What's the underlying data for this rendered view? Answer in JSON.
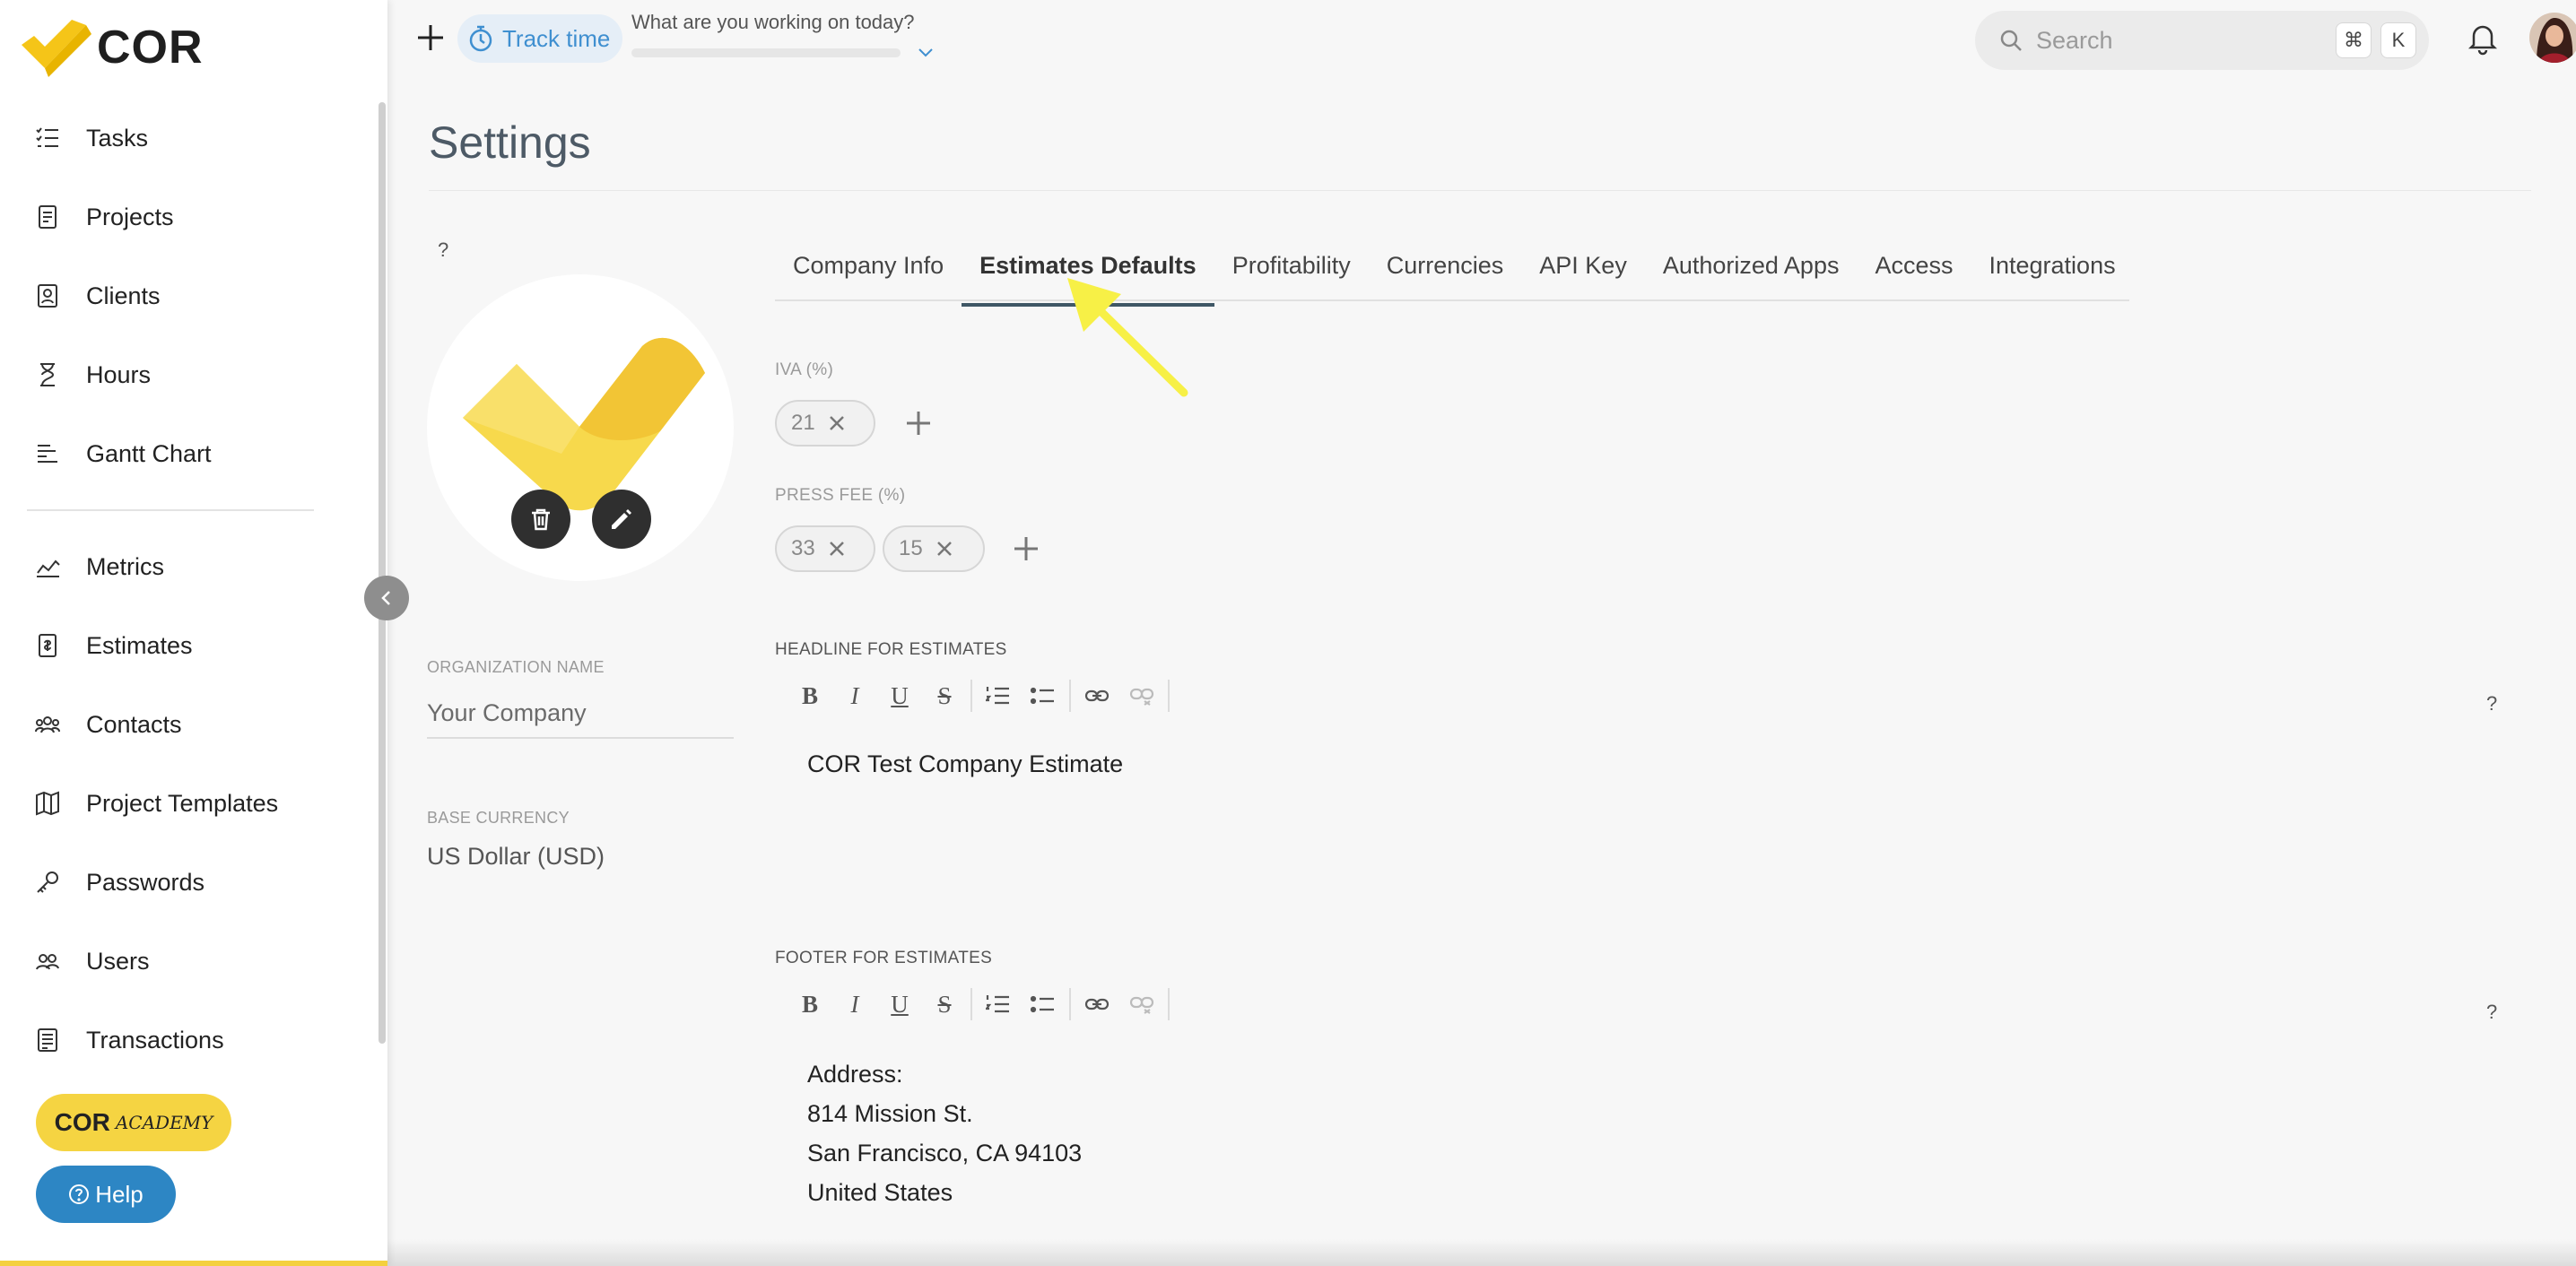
{
  "brand": {
    "name": "COR",
    "accent": "#f5d442"
  },
  "sidebar": {
    "items_top": [
      {
        "label": "Tasks",
        "icon": "tasks-icon"
      },
      {
        "label": "Projects",
        "icon": "projects-icon"
      },
      {
        "label": "Clients",
        "icon": "clients-icon"
      },
      {
        "label": "Hours",
        "icon": "hourglass-icon"
      },
      {
        "label": "Gantt Chart",
        "icon": "gantt-icon"
      }
    ],
    "items_bottom": [
      {
        "label": "Metrics",
        "icon": "metrics-icon"
      },
      {
        "label": "Estimates",
        "icon": "estimates-icon"
      },
      {
        "label": "Contacts",
        "icon": "contacts-icon"
      },
      {
        "label": "Project Templates",
        "icon": "map-icon"
      },
      {
        "label": "Passwords",
        "icon": "key-icon"
      },
      {
        "label": "Users",
        "icon": "users-icon"
      },
      {
        "label": "Transactions",
        "icon": "transactions-icon"
      }
    ],
    "academy": {
      "main": "COR",
      "sub": "ACADEMY"
    },
    "help_label": "Help"
  },
  "topbar": {
    "track_time": "Track time",
    "working_prompt": "What are you working on today?",
    "search_placeholder": "Search",
    "kbd_cmd": "⌘",
    "kbd_k": "K"
  },
  "page": {
    "title": "Settings",
    "help_mark": "?"
  },
  "organization": {
    "name_label": "ORGANIZATION NAME",
    "name_value": "Your Company",
    "currency_label": "BASE CURRENCY",
    "currency_value": "US Dollar (USD)"
  },
  "tabs": [
    {
      "label": "Company Info",
      "active": false
    },
    {
      "label": "Estimates Defaults",
      "active": true
    },
    {
      "label": "Profitability",
      "active": false
    },
    {
      "label": "Currencies",
      "active": false
    },
    {
      "label": "API Key",
      "active": false
    },
    {
      "label": "Authorized Apps",
      "active": false
    },
    {
      "label": "Access",
      "active": false
    },
    {
      "label": "Integrations",
      "active": false
    }
  ],
  "estimates": {
    "iva_label": "IVA (%)",
    "iva_values": [
      "21"
    ],
    "press_fee_label": "PRESS FEE (%)",
    "press_fee_values": [
      "33",
      "15"
    ],
    "headline_label": "HEADLINE FOR ESTIMATES",
    "headline_text": "COR Test Company Estimate",
    "footer_label": "FOOTER FOR ESTIMATES",
    "footer_lines": [
      "Address:",
      "814 Mission St.",
      "San Francisco, CA 94103",
      "United States"
    ],
    "help_mark": "?"
  },
  "toolbar": {
    "bold": "B",
    "italic": "I",
    "underline": "U",
    "strike": "S"
  }
}
